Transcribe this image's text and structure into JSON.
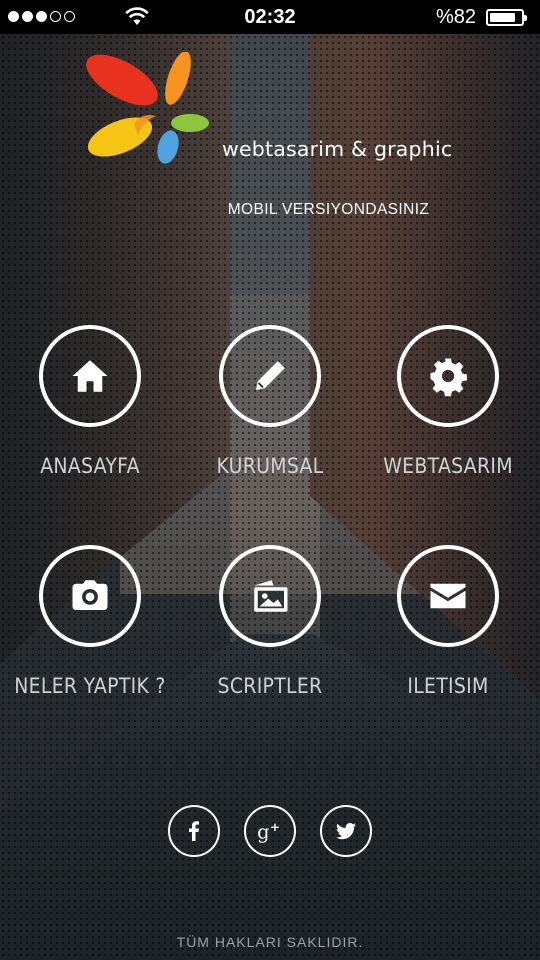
{
  "status_bar": {
    "signal_dots_filled": 3,
    "signal_dots_total": 5,
    "time": "02:32",
    "battery_text": "%82",
    "battery_level": 0.82
  },
  "brand": {
    "name": "webtasarim & graphic",
    "mobile_note": "MOBIL VERSIYONDASINIZ"
  },
  "menu": [
    {
      "label": "ANASAYFA",
      "icon": "home-icon"
    },
    {
      "label": "KURUMSAL",
      "icon": "pencil-icon"
    },
    {
      "label": "WEBTASARIM",
      "icon": "gear-icon"
    },
    {
      "label": "NELER YAPTIK ?",
      "icon": "camera-icon"
    },
    {
      "label": "SCRIPTLER",
      "icon": "pictures-icon"
    },
    {
      "label": "ILETISIM",
      "icon": "envelope-icon"
    }
  ],
  "social": [
    {
      "name": "facebook",
      "icon": "facebook-icon"
    },
    {
      "name": "google-plus",
      "icon": "google-plus-icon"
    },
    {
      "name": "twitter",
      "icon": "twitter-icon"
    }
  ],
  "footer": "TÜM HAKLARI SAKLIDIR.",
  "colors": {
    "logo_red": "#e8321e",
    "logo_orange": "#f7931e",
    "logo_yellow": "#f6c514",
    "logo_green": "#8cc63f",
    "logo_blue": "#4fa3e0"
  }
}
